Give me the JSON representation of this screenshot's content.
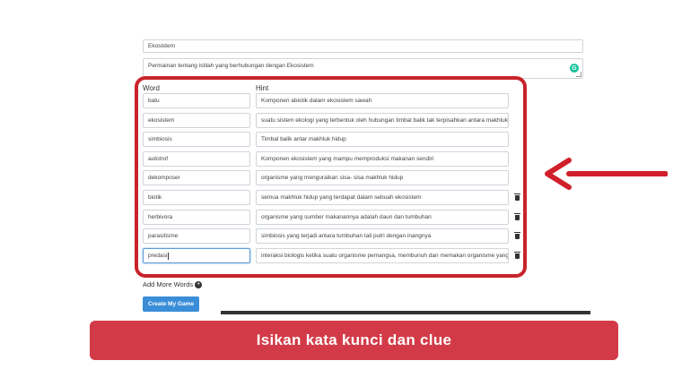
{
  "form": {
    "title_value": "Ekosistem",
    "description_value": "Permainan tentang istilah yang berhubungan dengan Ekosistem",
    "grammarly_icon": "grammarly-icon"
  },
  "table": {
    "word_header": "Word",
    "hint_header": "Hint",
    "rows": [
      {
        "word": "batu",
        "hint": "Komponen abiotik dalam ekosistem sawah",
        "deletable": false
      },
      {
        "word": "ekosistem",
        "hint": "suatu sistem ekologi yang terbentuk oleh hubungan timbal balik tak terpisahkan antara makhluk hidup",
        "deletable": false
      },
      {
        "word": "simbiosis",
        "hint": "Timbal balik antar makhluk hidup",
        "deletable": false
      },
      {
        "word": "autotrof",
        "hint": "Komponen ekosistem yang mampu memproduksi makanan sendiri",
        "deletable": false
      },
      {
        "word": "dekomposer",
        "hint": "organisme yang menguraikan sisa- sisa makhluk hidup",
        "deletable": false
      },
      {
        "word": "biotik",
        "hint": "semua makhluk hidup yang terdapat dalam sebuah ekosistem",
        "deletable": true
      },
      {
        "word": "herbivora",
        "hint": "organisme yang sumber makanannya adalah daun dan tumbuhan",
        "deletable": true
      },
      {
        "word": "parasitisme",
        "hint": "simbiosis yang terjadi antara tumbuhan tali putri dengan inangnya",
        "deletable": true
      },
      {
        "word": "predasi",
        "hint": "interaksi biologis ketika suatu organisme pemangsa, membunuh dan memakan organisme yang lain (",
        "deletable": true
      }
    ]
  },
  "actions": {
    "add_more_label": "Add More Words",
    "create_label": "Create My Game"
  },
  "annotation": {
    "caption": "Isikan kata kunci dan clue",
    "highlight_color": "#c8232c",
    "caption_color": "#d33a48"
  }
}
